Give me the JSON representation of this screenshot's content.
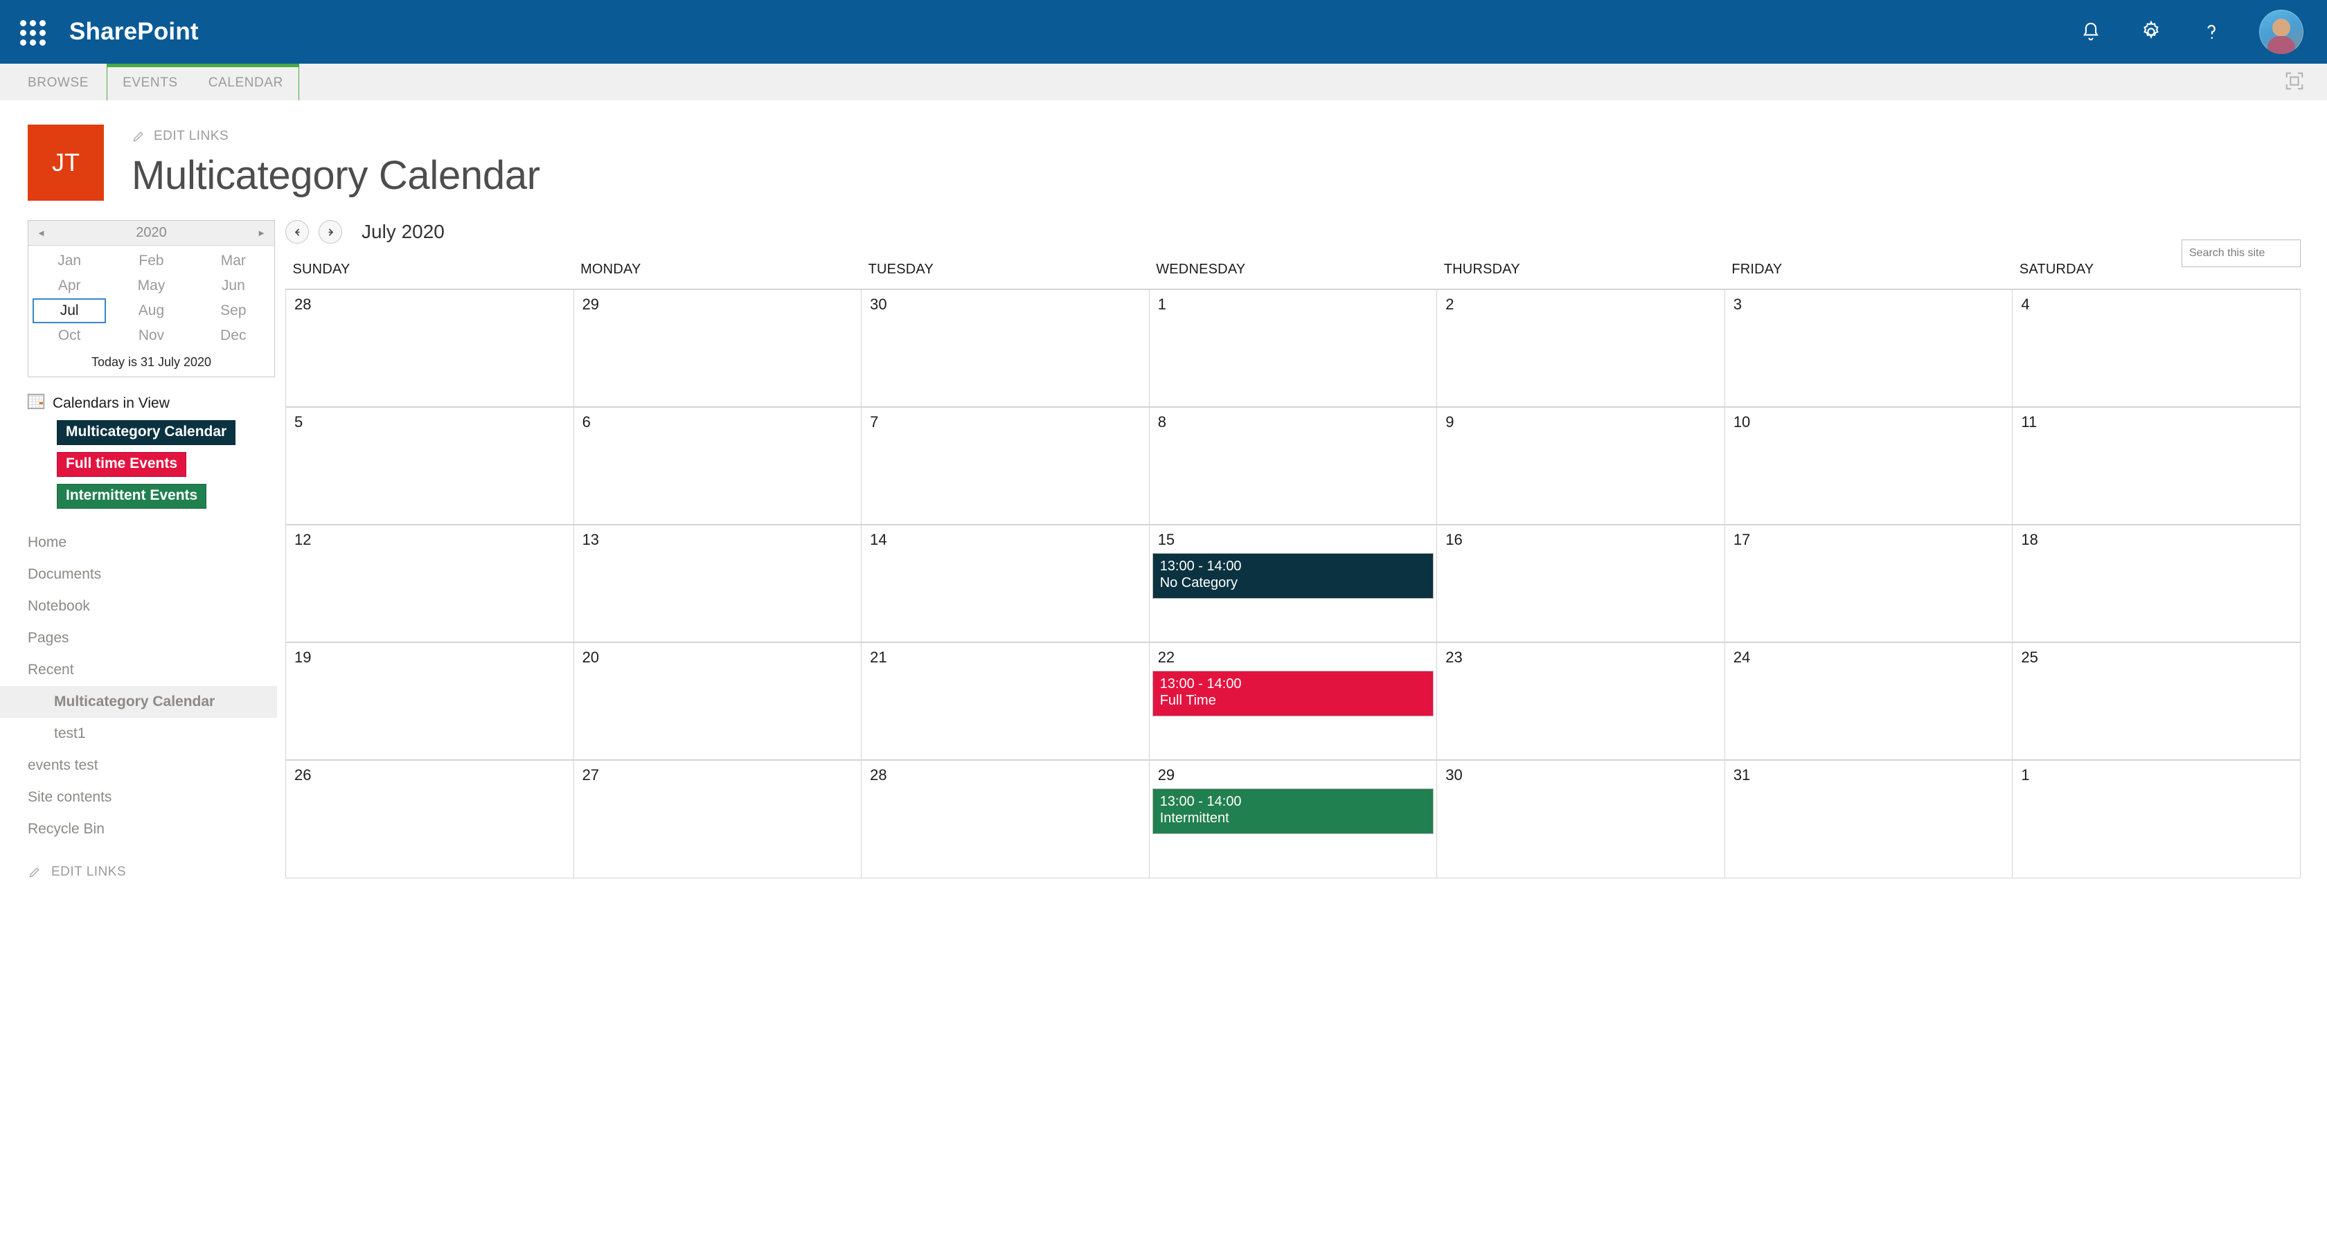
{
  "suite": {
    "title": "SharePoint",
    "icons": {
      "waffle": "app-launcher-icon",
      "bell": "notifications-icon",
      "gear": "settings-icon",
      "help": "help-icon",
      "avatar": "user-avatar"
    }
  },
  "ribbon": {
    "browse": "BROWSE",
    "events": "EVENTS",
    "calendar": "CALENDAR",
    "focus": "focus-on-content-icon",
    "accent": "#4aa845"
  },
  "site": {
    "logo_initials": "JT",
    "logo_color": "#e03e11",
    "edit_links": "EDIT LINKS",
    "title": "Multicategory Calendar"
  },
  "search": {
    "placeholder": "Search this site",
    "value": ""
  },
  "month_picker": {
    "year": "2020",
    "prev": "◄",
    "next": "►",
    "months": [
      "Jan",
      "Feb",
      "Mar",
      "Apr",
      "May",
      "Jun",
      "Jul",
      "Aug",
      "Sep",
      "Oct",
      "Nov",
      "Dec"
    ],
    "selected": "Jul",
    "today_text": "Today is 31 July 2020"
  },
  "calendars_in_view": {
    "label": "Calendars in View",
    "items": [
      {
        "name": "Multicategory Calendar",
        "color": "#0b3240"
      },
      {
        "name": "Full time Events",
        "color": "#e3133f"
      },
      {
        "name": "Intermittent Events",
        "color": "#21804f"
      }
    ]
  },
  "nav": {
    "items": [
      {
        "label": "Home",
        "sub": false,
        "active": false
      },
      {
        "label": "Documents",
        "sub": false,
        "active": false
      },
      {
        "label": "Notebook",
        "sub": false,
        "active": false
      },
      {
        "label": "Pages",
        "sub": false,
        "active": false
      },
      {
        "label": "Recent",
        "sub": false,
        "active": false
      },
      {
        "label": "Multicategory Calendar",
        "sub": true,
        "active": true
      },
      {
        "label": "test1",
        "sub": true,
        "active": false
      },
      {
        "label": "events test",
        "sub": false,
        "active": false
      },
      {
        "label": "Site contents",
        "sub": false,
        "active": false
      },
      {
        "label": "Recycle Bin",
        "sub": false,
        "active": false
      }
    ],
    "edit_links": "EDIT LINKS"
  },
  "calendar": {
    "period": "July 2020",
    "prev_label": "previous-month",
    "next_label": "next-month",
    "weekday_headers": [
      "SUNDAY",
      "MONDAY",
      "TUESDAY",
      "WEDNESDAY",
      "THURSDAY",
      "FRIDAY",
      "SATURDAY"
    ],
    "weeks": [
      [
        {
          "day": "28",
          "today": false,
          "events": []
        },
        {
          "day": "29",
          "today": false,
          "events": []
        },
        {
          "day": "30",
          "today": false,
          "events": []
        },
        {
          "day": "1",
          "today": false,
          "events": []
        },
        {
          "day": "2",
          "today": false,
          "events": []
        },
        {
          "day": "3",
          "today": false,
          "events": []
        },
        {
          "day": "4",
          "today": false,
          "events": []
        }
      ],
      [
        {
          "day": "5",
          "today": false,
          "events": []
        },
        {
          "day": "6",
          "today": false,
          "events": []
        },
        {
          "day": "7",
          "today": false,
          "events": []
        },
        {
          "day": "8",
          "today": false,
          "events": []
        },
        {
          "day": "9",
          "today": false,
          "events": []
        },
        {
          "day": "10",
          "today": false,
          "events": []
        },
        {
          "day": "11",
          "today": false,
          "events": []
        }
      ],
      [
        {
          "day": "12",
          "today": false,
          "events": []
        },
        {
          "day": "13",
          "today": false,
          "events": []
        },
        {
          "day": "14",
          "today": false,
          "events": []
        },
        {
          "day": "15",
          "today": false,
          "events": [
            {
              "time": "13:00 - 14:00",
              "title": "No Category",
              "color": "#0b3240"
            }
          ]
        },
        {
          "day": "16",
          "today": false,
          "events": []
        },
        {
          "day": "17",
          "today": false,
          "events": []
        },
        {
          "day": "18",
          "today": false,
          "events": []
        }
      ],
      [
        {
          "day": "19",
          "today": false,
          "events": []
        },
        {
          "day": "20",
          "today": false,
          "events": []
        },
        {
          "day": "21",
          "today": false,
          "events": []
        },
        {
          "day": "22",
          "today": false,
          "events": [
            {
              "time": "13:00 - 14:00",
              "title": "Full Time",
              "color": "#e3133f"
            }
          ]
        },
        {
          "day": "23",
          "today": false,
          "events": []
        },
        {
          "day": "24",
          "today": false,
          "events": []
        },
        {
          "day": "25",
          "today": false,
          "events": []
        }
      ],
      [
        {
          "day": "26",
          "today": false,
          "events": []
        },
        {
          "day": "27",
          "today": false,
          "events": []
        },
        {
          "day": "28",
          "today": false,
          "events": []
        },
        {
          "day": "29",
          "today": false,
          "events": [
            {
              "time": "13:00 - 14:00",
              "title": "Intermittent",
              "color": "#21804f"
            }
          ]
        },
        {
          "day": "30",
          "today": false,
          "events": []
        },
        {
          "day": "31",
          "today": true,
          "events": []
        },
        {
          "day": "1",
          "today": false,
          "events": []
        }
      ]
    ]
  }
}
